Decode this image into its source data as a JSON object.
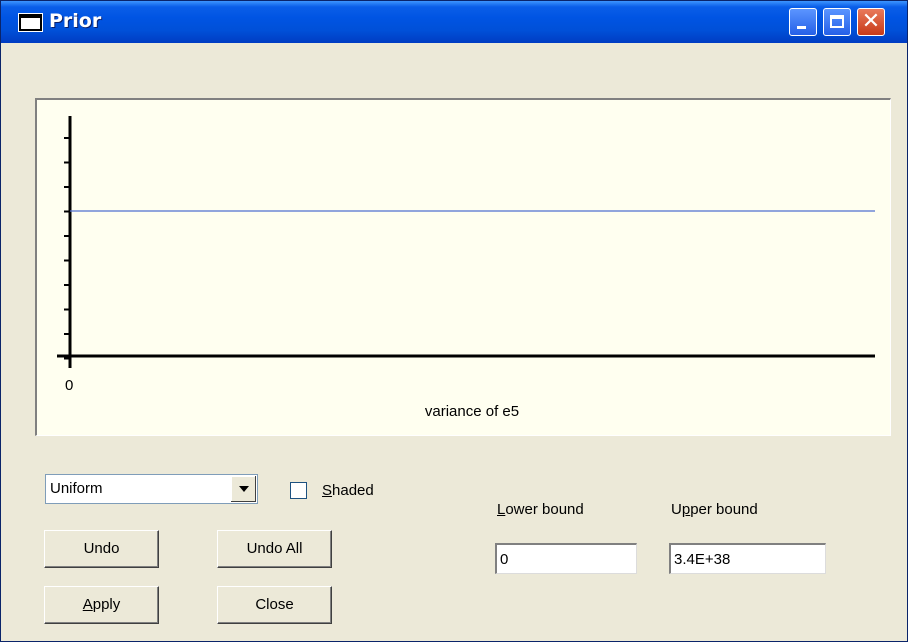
{
  "window": {
    "title": "Prior"
  },
  "plot": {
    "x_tick_label": "0",
    "xlabel": "variance of e5",
    "line_color": "#4f6fd0"
  },
  "chart_data": {
    "type": "line",
    "title": "",
    "xlabel": "variance of e5",
    "ylabel": "",
    "x_ticks": [
      "0"
    ],
    "series": [
      {
        "description_free": true,
        "values": "constant density (uniform)"
      }
    ],
    "grid": false
  },
  "controls": {
    "distribution": {
      "selected": "Uniform"
    },
    "shaded": {
      "label_prefix": "",
      "label_accel": "S",
      "label_rest": "haded",
      "checked": false
    },
    "undo_label": "Undo",
    "undo_all_label": "Undo All",
    "apply_accel": "A",
    "apply_rest": "pply",
    "close_label": "Close"
  },
  "bounds": {
    "lower_accel": "L",
    "lower_rest": "ower bound",
    "upper_prefix": "U",
    "upper_accel": "p",
    "upper_rest": "per bound",
    "lower_value": "0",
    "upper_value": "3.4E+38"
  }
}
